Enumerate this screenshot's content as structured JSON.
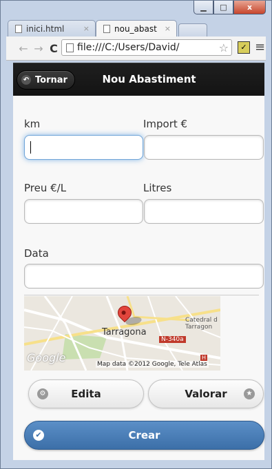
{
  "browser": {
    "tabs": [
      {
        "label": "inici.html",
        "close": "×"
      },
      {
        "label": "nou_abast",
        "close": "×"
      }
    ],
    "url": "file:///C:/Users/David/",
    "window_controls": {
      "minimize": "▁",
      "maximize": "□",
      "close": "x"
    }
  },
  "header": {
    "back_label": "Tornar",
    "title": "Nou Abastiment"
  },
  "form": {
    "km_label": "km",
    "import_label": "Import €",
    "preu_label": "Preu €/L",
    "litres_label": "Litres",
    "data_label": "Data",
    "km_value": "",
    "import_value": "",
    "preu_value": "",
    "litres_value": "",
    "data_value": ""
  },
  "map": {
    "city": "Tarragona",
    "catedral": "Catedral d\nTarragon",
    "road": "N-340a",
    "logo": "Google",
    "attribution": "Map data ©2012 Google, Tele Atlas"
  },
  "actions": {
    "edit_label": "Edita",
    "rate_label": "Valorar",
    "create_label": "Crear"
  }
}
